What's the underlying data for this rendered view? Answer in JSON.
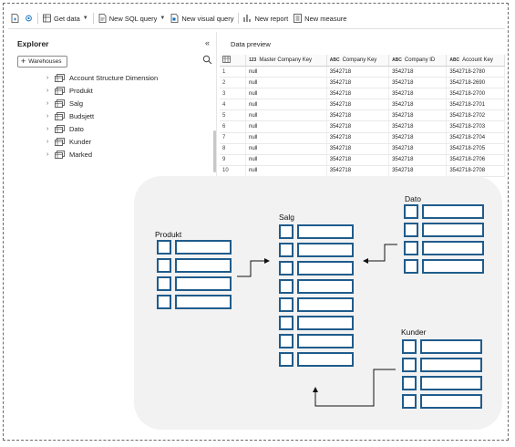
{
  "toolbar": {
    "get_data": "Get data",
    "new_sql_query": "New SQL query",
    "new_visual_query": "New visual query",
    "new_report": "New report",
    "new_measure": "New measure"
  },
  "explorer": {
    "title": "Explorer",
    "warehouses_button": "Warehouses",
    "items": [
      "Account Structure Dimension",
      "Produkt",
      "Salg",
      "Budsjett",
      "Dato",
      "Kunder",
      "Marked"
    ]
  },
  "preview": {
    "title": "Data preview",
    "columns": [
      {
        "type": "123",
        "name": "Master Company Key"
      },
      {
        "type": "ABC",
        "name": "Company Key"
      },
      {
        "type": "ABC",
        "name": "Company ID"
      },
      {
        "type": "ABC",
        "name": "Account Key"
      }
    ],
    "rows": [
      [
        "1",
        "null",
        "3542718",
        "3542718",
        "3542718-2780"
      ],
      [
        "2",
        "null",
        "3542718",
        "3542718",
        "3542718-2690"
      ],
      [
        "3",
        "null",
        "3542718",
        "3542718",
        "3542718-2700"
      ],
      [
        "4",
        "null",
        "3542718",
        "3542718",
        "3542718-2701"
      ],
      [
        "5",
        "null",
        "3542718",
        "3542718",
        "3542718-2702"
      ],
      [
        "6",
        "null",
        "3542718",
        "3542718",
        "3542718-2703"
      ],
      [
        "7",
        "null",
        "3542718",
        "3542718",
        "3542718-2704"
      ],
      [
        "8",
        "null",
        "3542718",
        "3542718",
        "3542718-2705"
      ],
      [
        "9",
        "null",
        "3542718",
        "3542718",
        "3542718-2706"
      ],
      [
        "10",
        "null",
        "3542718",
        "3542718",
        "3542718-2708"
      ]
    ]
  },
  "diagram": {
    "produkt": "Produkt",
    "salg": "Salg",
    "dato": "Dato",
    "kunder": "Kunder"
  },
  "colors": {
    "table_blue": "#1f5c8c",
    "panel_bg": "#f2f2f2",
    "accent": "#0f6cbd"
  },
  "icons": [
    "new-item-icon",
    "settings-icon",
    "get-data-icon",
    "sql-icon",
    "visual-query-icon",
    "report-icon",
    "measure-icon",
    "search-icon",
    "table-icon",
    "chevron-right-icon",
    "collapse-icon"
  ]
}
